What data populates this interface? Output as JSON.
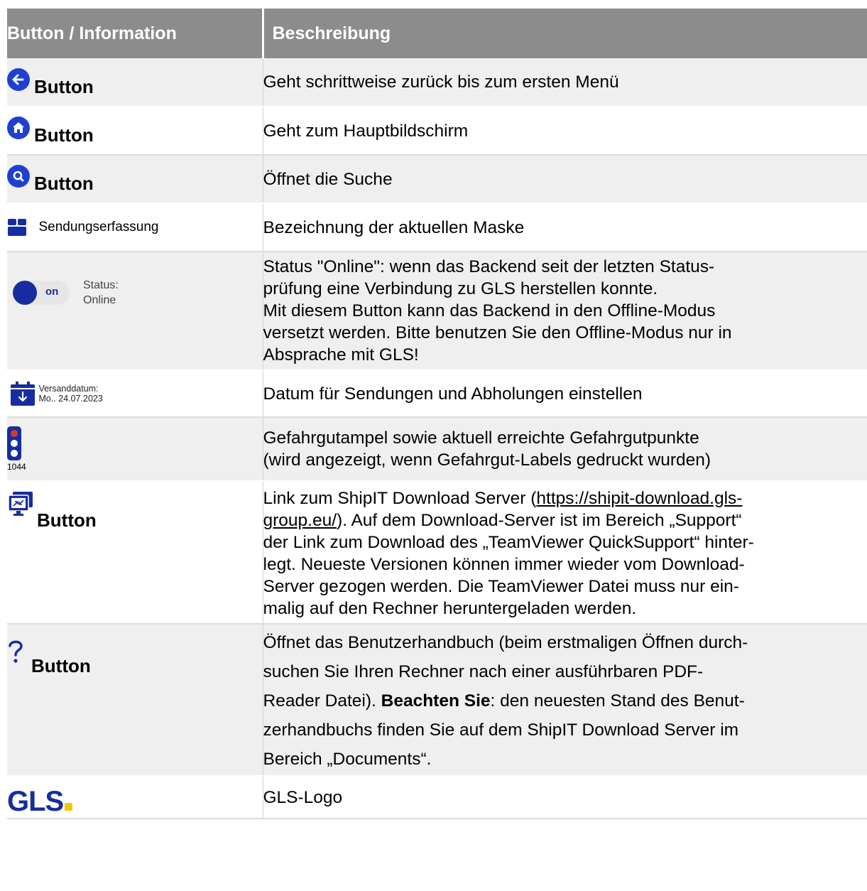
{
  "header": {
    "col1": "Button / Information",
    "col2": "Beschreibung"
  },
  "rows": [
    {
      "label": "Button",
      "desc": "Geht schrittweise zurück bis zum ersten Menü",
      "icon": "back-arrow-icon"
    },
    {
      "label": "Button",
      "desc": "Geht zum Hauptbildschirm",
      "icon": "home-icon"
    },
    {
      "label": "Button",
      "desc": "Öffnet die Suche",
      "icon": "search-icon"
    },
    {
      "label": "Sendungserfassung",
      "desc": "Bezeichnung der aktuellen Maske",
      "icon": "package-icon"
    },
    {
      "toggle": "on",
      "status_label": "Status:",
      "status_value": "Online",
      "desc": [
        "Status \"Online\": wenn das Backend seit der letzten Status-",
        "prüfung eine Verbindung zu GLS herstellen konnte.",
        "Mit diesem Button kann das Backend in den Offline-Modus",
        "versetzt werden. Bitte benutzen Sie den Offline-Modus nur in",
        "Absprache mit GLS!"
      ]
    },
    {
      "date_label": "Versanddatum:",
      "date_value": "Mo.. 24.07.2023",
      "desc": "Datum für Sendungen und Abholungen einstellen",
      "icon": "calendar-icon"
    },
    {
      "points": "1044",
      "desc": [
        "Gefahrgutampel sowie aktuell erreichte Gefahrgutpunkte",
        "(wird angezeigt, wenn Gefahrgut-Labels gedruckt wurden)"
      ],
      "icon": "traffic-light-icon"
    },
    {
      "label": "Button",
      "icon": "remote-support-icon",
      "desc_pre": "Link zum ShipIT Download Server (",
      "link1": "https://shipit-download.gls-",
      "link2": "group.eu/",
      "desc_post": "). Auf dem Download-Server ist im Bereich „Support“",
      "desc_lines": [
        "der Link zum Download des „TeamViewer QuickSupport“ hinter-",
        "legt. Neueste Versionen können immer wieder vom Download-",
        "Server gezogen werden. Die TeamViewer Datei muss nur ein-",
        "malig auf den Rechner heruntergeladen werden."
      ]
    },
    {
      "label": "Button",
      "icon": "help-icon",
      "desc_lines_a": [
        "Öffnet das Benutzerhandbuch (beim erstmaligen Öffnen durch-",
        "suchen Sie Ihren Rechner nach einer ausführbaren PDF-"
      ],
      "desc_line_c_pre": "Reader Datei). ",
      "desc_bold": "Beachten Sie",
      "desc_line_c_post": ": den neuesten Stand des Benut-",
      "desc_lines_b": [
        "zerhandbuchs finden Sie auf dem ShipIT Download Server im",
        "Bereich „Documents“."
      ]
    },
    {
      "logo_text": "GLS",
      "desc": "GLS-Logo"
    }
  ],
  "colors": {
    "header_bg": "#8c8c8c",
    "row_bg": "#efefef",
    "brand_blue": "#1f3fd3",
    "navy": "#172d9f",
    "gls_yellow": "#f7c600"
  }
}
